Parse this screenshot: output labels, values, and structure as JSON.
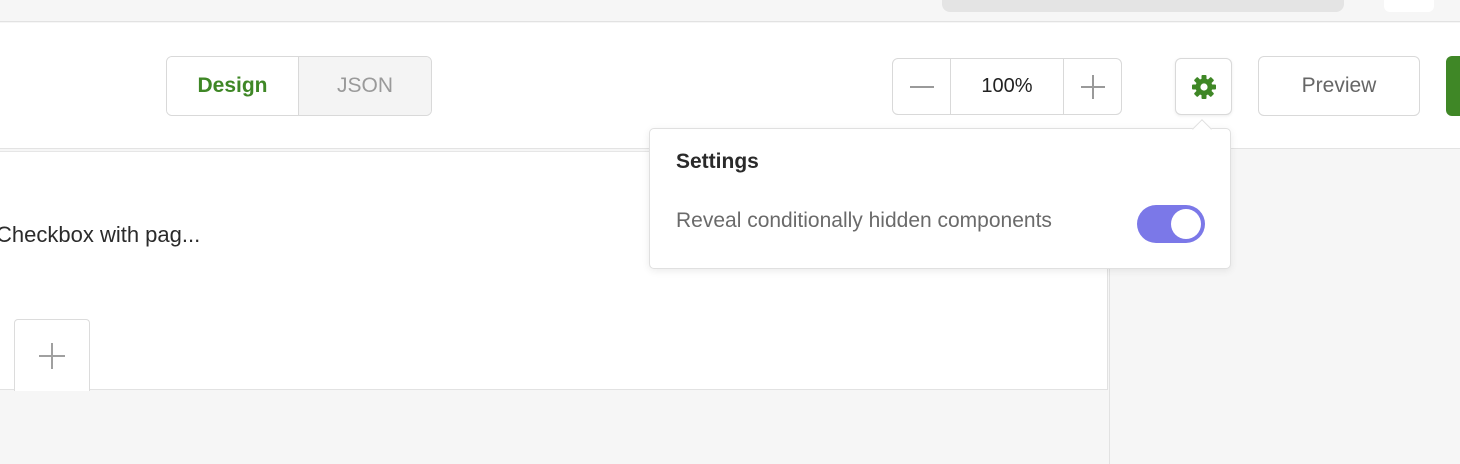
{
  "toolbar": {
    "mode_tabs": [
      {
        "label": "Design",
        "active": true
      },
      {
        "label": "JSON",
        "active": false
      }
    ],
    "zoom": {
      "value": "100%"
    },
    "settings_icon": "gear-icon",
    "preview_label": "Preview"
  },
  "canvas": {
    "item_title": "Checkbox with pag..."
  },
  "settings_popover": {
    "title": "Settings",
    "options": [
      {
        "label": "Reveal conditionally hidden components",
        "enabled": true
      }
    ]
  },
  "colors": {
    "accent_green": "#3f8726",
    "toggle_on": "#7b78e8"
  }
}
